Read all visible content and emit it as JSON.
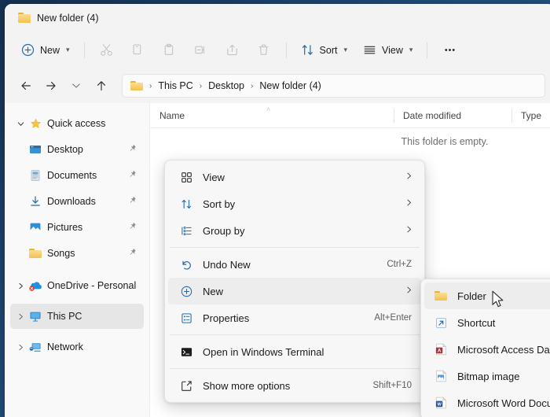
{
  "window": {
    "tab_title": "New folder (4)",
    "tab_icon": "folder-icon"
  },
  "toolbar": {
    "new_label": "New",
    "new_icon": "plus-circle-icon",
    "sort_label": "Sort",
    "sort_icon": "sort-arrows-icon",
    "view_label": "View",
    "view_icon": "list-lines-icon",
    "more_label": "•••",
    "icons": [
      {
        "name": "cut-icon",
        "disabled": true
      },
      {
        "name": "copy-icon",
        "disabled": true
      },
      {
        "name": "paste-icon",
        "disabled": true
      },
      {
        "name": "rename-icon",
        "disabled": true
      },
      {
        "name": "share-icon",
        "disabled": true
      },
      {
        "name": "delete-icon",
        "disabled": true
      }
    ]
  },
  "addressbar": {
    "back_icon": "arrow-left-icon",
    "forward_icon": "arrow-right-icon",
    "recent_icon": "chevron-down-icon",
    "up_icon": "arrow-up-icon",
    "path_icon": "folder-icon",
    "crumbs": [
      "This PC",
      "Desktop",
      "New folder (4)"
    ],
    "separator": "›"
  },
  "sidebar": {
    "items": [
      {
        "label": "Quick access",
        "icon": "star-icon",
        "expander": "chevron-down",
        "child": false,
        "pinned": false,
        "selected": false
      },
      {
        "label": "Desktop",
        "icon": "desktop-icon",
        "expander": "",
        "child": true,
        "pinned": true,
        "selected": false
      },
      {
        "label": "Documents",
        "icon": "documents-icon",
        "expander": "",
        "child": true,
        "pinned": true,
        "selected": false
      },
      {
        "label": "Downloads",
        "icon": "downloads-icon",
        "expander": "",
        "child": true,
        "pinned": true,
        "selected": false
      },
      {
        "label": "Pictures",
        "icon": "pictures-icon",
        "expander": "",
        "child": true,
        "pinned": true,
        "selected": false
      },
      {
        "label": "Songs",
        "icon": "folder-icon",
        "expander": "",
        "child": true,
        "pinned": true,
        "selected": false
      },
      {
        "label": "OneDrive - Personal",
        "icon": "onedrive-error-icon",
        "expander": "chevron-right",
        "child": false,
        "pinned": false,
        "selected": false
      },
      {
        "label": "This PC",
        "icon": "thispc-icon",
        "expander": "chevron-right",
        "child": false,
        "pinned": false,
        "selected": true
      },
      {
        "label": "Network",
        "icon": "network-icon",
        "expander": "chevron-right",
        "child": false,
        "pinned": false,
        "selected": false
      }
    ]
  },
  "filelist": {
    "columns": [
      "Name",
      "Date modified",
      "Type"
    ],
    "sort_caret": "˄",
    "empty_message": "This folder is empty."
  },
  "context_menu": {
    "items": [
      {
        "label": "View",
        "icon": "grid-view-icon",
        "accel": "",
        "submenu": true,
        "highlight": false,
        "sep_after": false
      },
      {
        "label": "Sort by",
        "icon": "sort-arrows-icon",
        "accel": "",
        "submenu": true,
        "highlight": false,
        "sep_after": false
      },
      {
        "label": "Group by",
        "icon": "group-list-icon",
        "accel": "",
        "submenu": true,
        "highlight": false,
        "sep_after": true
      },
      {
        "label": "Undo New",
        "icon": "undo-icon",
        "accel": "Ctrl+Z",
        "submenu": false,
        "highlight": false,
        "sep_after": false
      },
      {
        "label": "New",
        "icon": "plus-circle-icon",
        "accel": "",
        "submenu": true,
        "highlight": true,
        "sep_after": false
      },
      {
        "label": "Properties",
        "icon": "properties-icon",
        "accel": "Alt+Enter",
        "submenu": false,
        "highlight": false,
        "sep_after": true
      },
      {
        "label": "Open in Windows Terminal",
        "icon": "terminal-icon",
        "accel": "",
        "submenu": false,
        "highlight": false,
        "sep_after": true
      },
      {
        "label": "Show more options",
        "icon": "show-more-icon",
        "accel": "Shift+F10",
        "submenu": false,
        "highlight": false,
        "sep_after": false
      }
    ]
  },
  "submenu": {
    "items": [
      {
        "label": "Folder",
        "icon": "folder-icon",
        "highlight": true
      },
      {
        "label": "Shortcut",
        "icon": "shortcut-icon",
        "highlight": false
      },
      {
        "label": "Microsoft Access Database",
        "icon": "access-icon",
        "highlight": false
      },
      {
        "label": "Bitmap image",
        "icon": "bitmap-icon",
        "highlight": false
      },
      {
        "label": "Microsoft Word Document",
        "icon": "word-icon",
        "highlight": false
      }
    ]
  },
  "cursor": {
    "icon": "arrow-pointer-icon"
  },
  "colors": {
    "accent": "#2c6ba8",
    "window_bg": "#f3f3f3",
    "content_bg": "#ffffff",
    "sidebar_bg": "#f9f9f9",
    "menu_bg": "#f7f7f7",
    "highlight": "#ededed",
    "selected": "#e6e6e6",
    "folder_yellow": "#f2c14e",
    "desktop_blue": "#23507f"
  }
}
